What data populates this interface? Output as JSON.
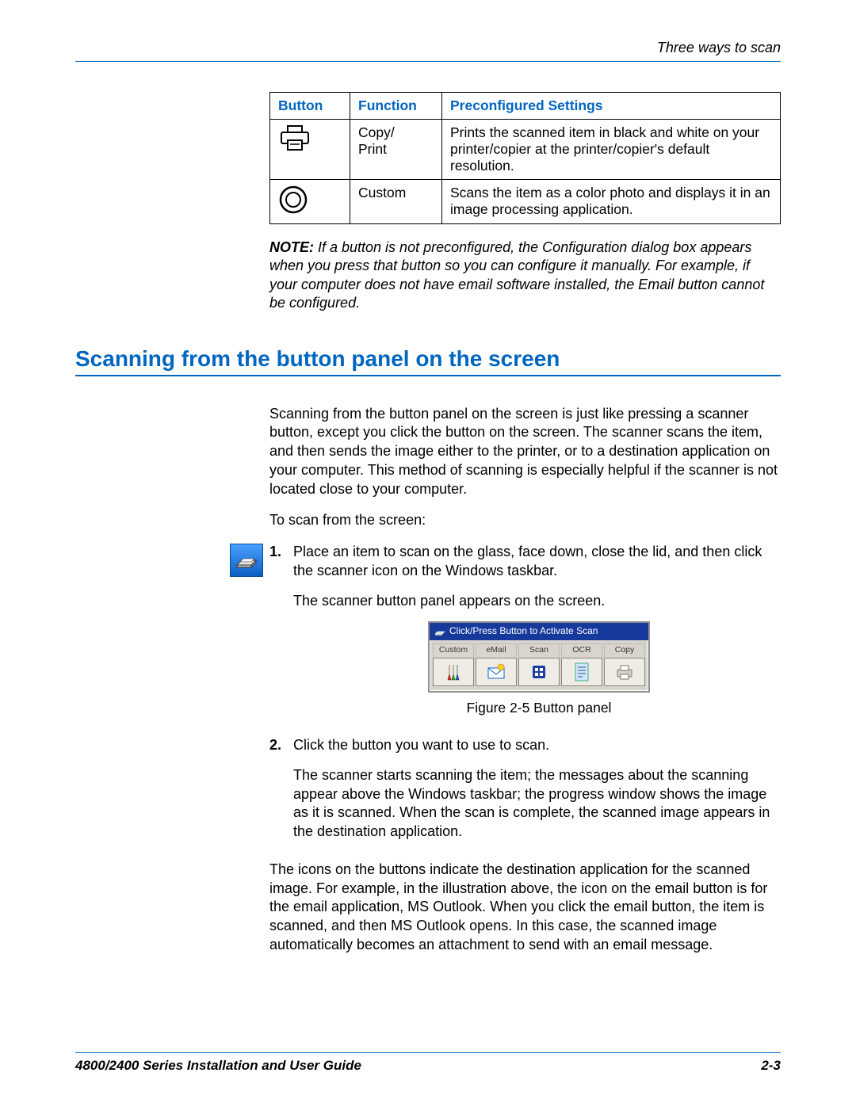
{
  "header": {
    "section_title": "Three ways to scan"
  },
  "table": {
    "headers": {
      "button": "Button",
      "function": "Function",
      "settings": "Preconfigured Settings"
    },
    "rows": [
      {
        "icon": "printer-icon",
        "function": "Copy/\nPrint",
        "settings": "Prints the scanned item in black and white on your printer/copier at the printer/copier's default resolution."
      },
      {
        "icon": "custom-circle-icon",
        "function": "Custom",
        "settings": "Scans the item as a color photo and displays it in an image processing application."
      }
    ]
  },
  "note": {
    "label": "NOTE:",
    "text": " If a button is not preconfigured, the Configuration dialog box appears when you press that button so you can configure it manually. For example, if your computer does not have email software installed, the Email button cannot be configured."
  },
  "heading": "Scanning from the button panel on the screen",
  "intro": "Scanning from the button panel on the screen is just like pressing a scanner button, except you click the button on the screen. The scanner scans the item, and then sends the image either to the printer, or to a destination application on your computer. This method of scanning is especially helpful if the scanner is not located close to your computer.",
  "lead_in": "To scan from the screen:",
  "steps": [
    {
      "num": "1.",
      "text": "Place an item to scan on the glass, face down, close the lid, and then click the scanner icon on the Windows taskbar.",
      "after": "The scanner button panel appears on the screen."
    },
    {
      "num": "2.",
      "text": "Click the button you want to use to scan.",
      "after": "The scanner starts scanning the item; the messages about the scanning appear above the Windows taskbar; the progress window shows the image as it is scanned. When the scan is complete, the scanned image appears in the destination application."
    }
  ],
  "panel": {
    "title": "Click/Press Button to Activate Scan",
    "buttons": [
      "Custom",
      "eMail",
      "Scan",
      "OCR",
      "Copy"
    ]
  },
  "figure_caption": "Figure 2-5 Button panel",
  "closing": "The icons on the buttons indicate the destination application for the scanned image. For example, in the illustration above, the icon on the email button is for the email application, MS Outlook. When you click the email button, the item is scanned, and then MS Outlook opens. In this case, the scanned image automatically becomes an attachment to send with an email message.",
  "footer": {
    "guide": "4800/2400 Series Installation and User Guide",
    "page": "2-3"
  }
}
